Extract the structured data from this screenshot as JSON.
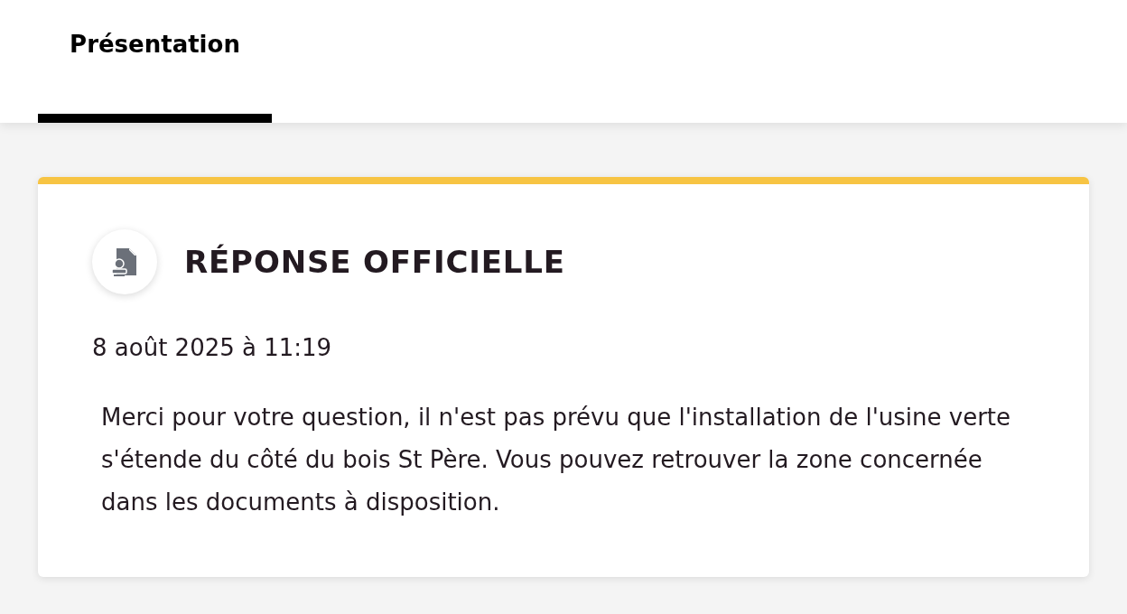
{
  "tabs": [
    {
      "label": "Présentation",
      "selected": true
    }
  ],
  "response": {
    "title": "RÉPONSE OFFICIELLE",
    "date": "8 août 2025 à 11:19",
    "body": "Merci pour votre question, il n'est pas prévu que l'installation de l'usine verte s'étende du côté du bois St Père. Vous pouvez retrouver la zone concernée dans les documents à disposition."
  }
}
